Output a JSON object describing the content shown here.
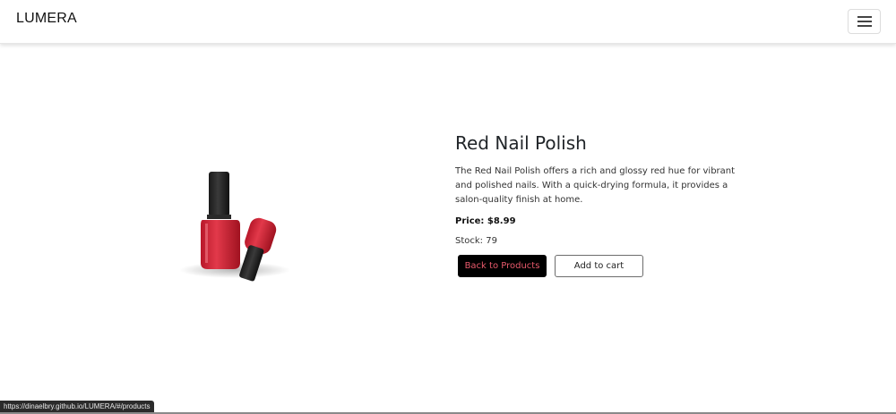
{
  "navbar": {
    "brand": "LUMERA",
    "menu_icon": "hamburger-menu-icon"
  },
  "product": {
    "image_icon": "red-nail-polish-image",
    "title": "Red Nail Polish",
    "description": "The Red Nail Polish offers a rich and glossy red hue for vibrant and polished nails. With a quick-drying formula, it provides a salon-quality finish at home.",
    "price_label": "Price:",
    "price": "$8.99",
    "stock_label": "Stock:",
    "stock": "79"
  },
  "actions": {
    "back_label": "Back to Products",
    "cart_label": "Add to cart"
  },
  "status_bar": {
    "url": "https://dinaelbry.github.io/LUMERA/#/products"
  },
  "colors": {
    "back_button_bg": "#000000",
    "back_button_text": "#e85a6c",
    "polish_red": "#d42a3a"
  }
}
